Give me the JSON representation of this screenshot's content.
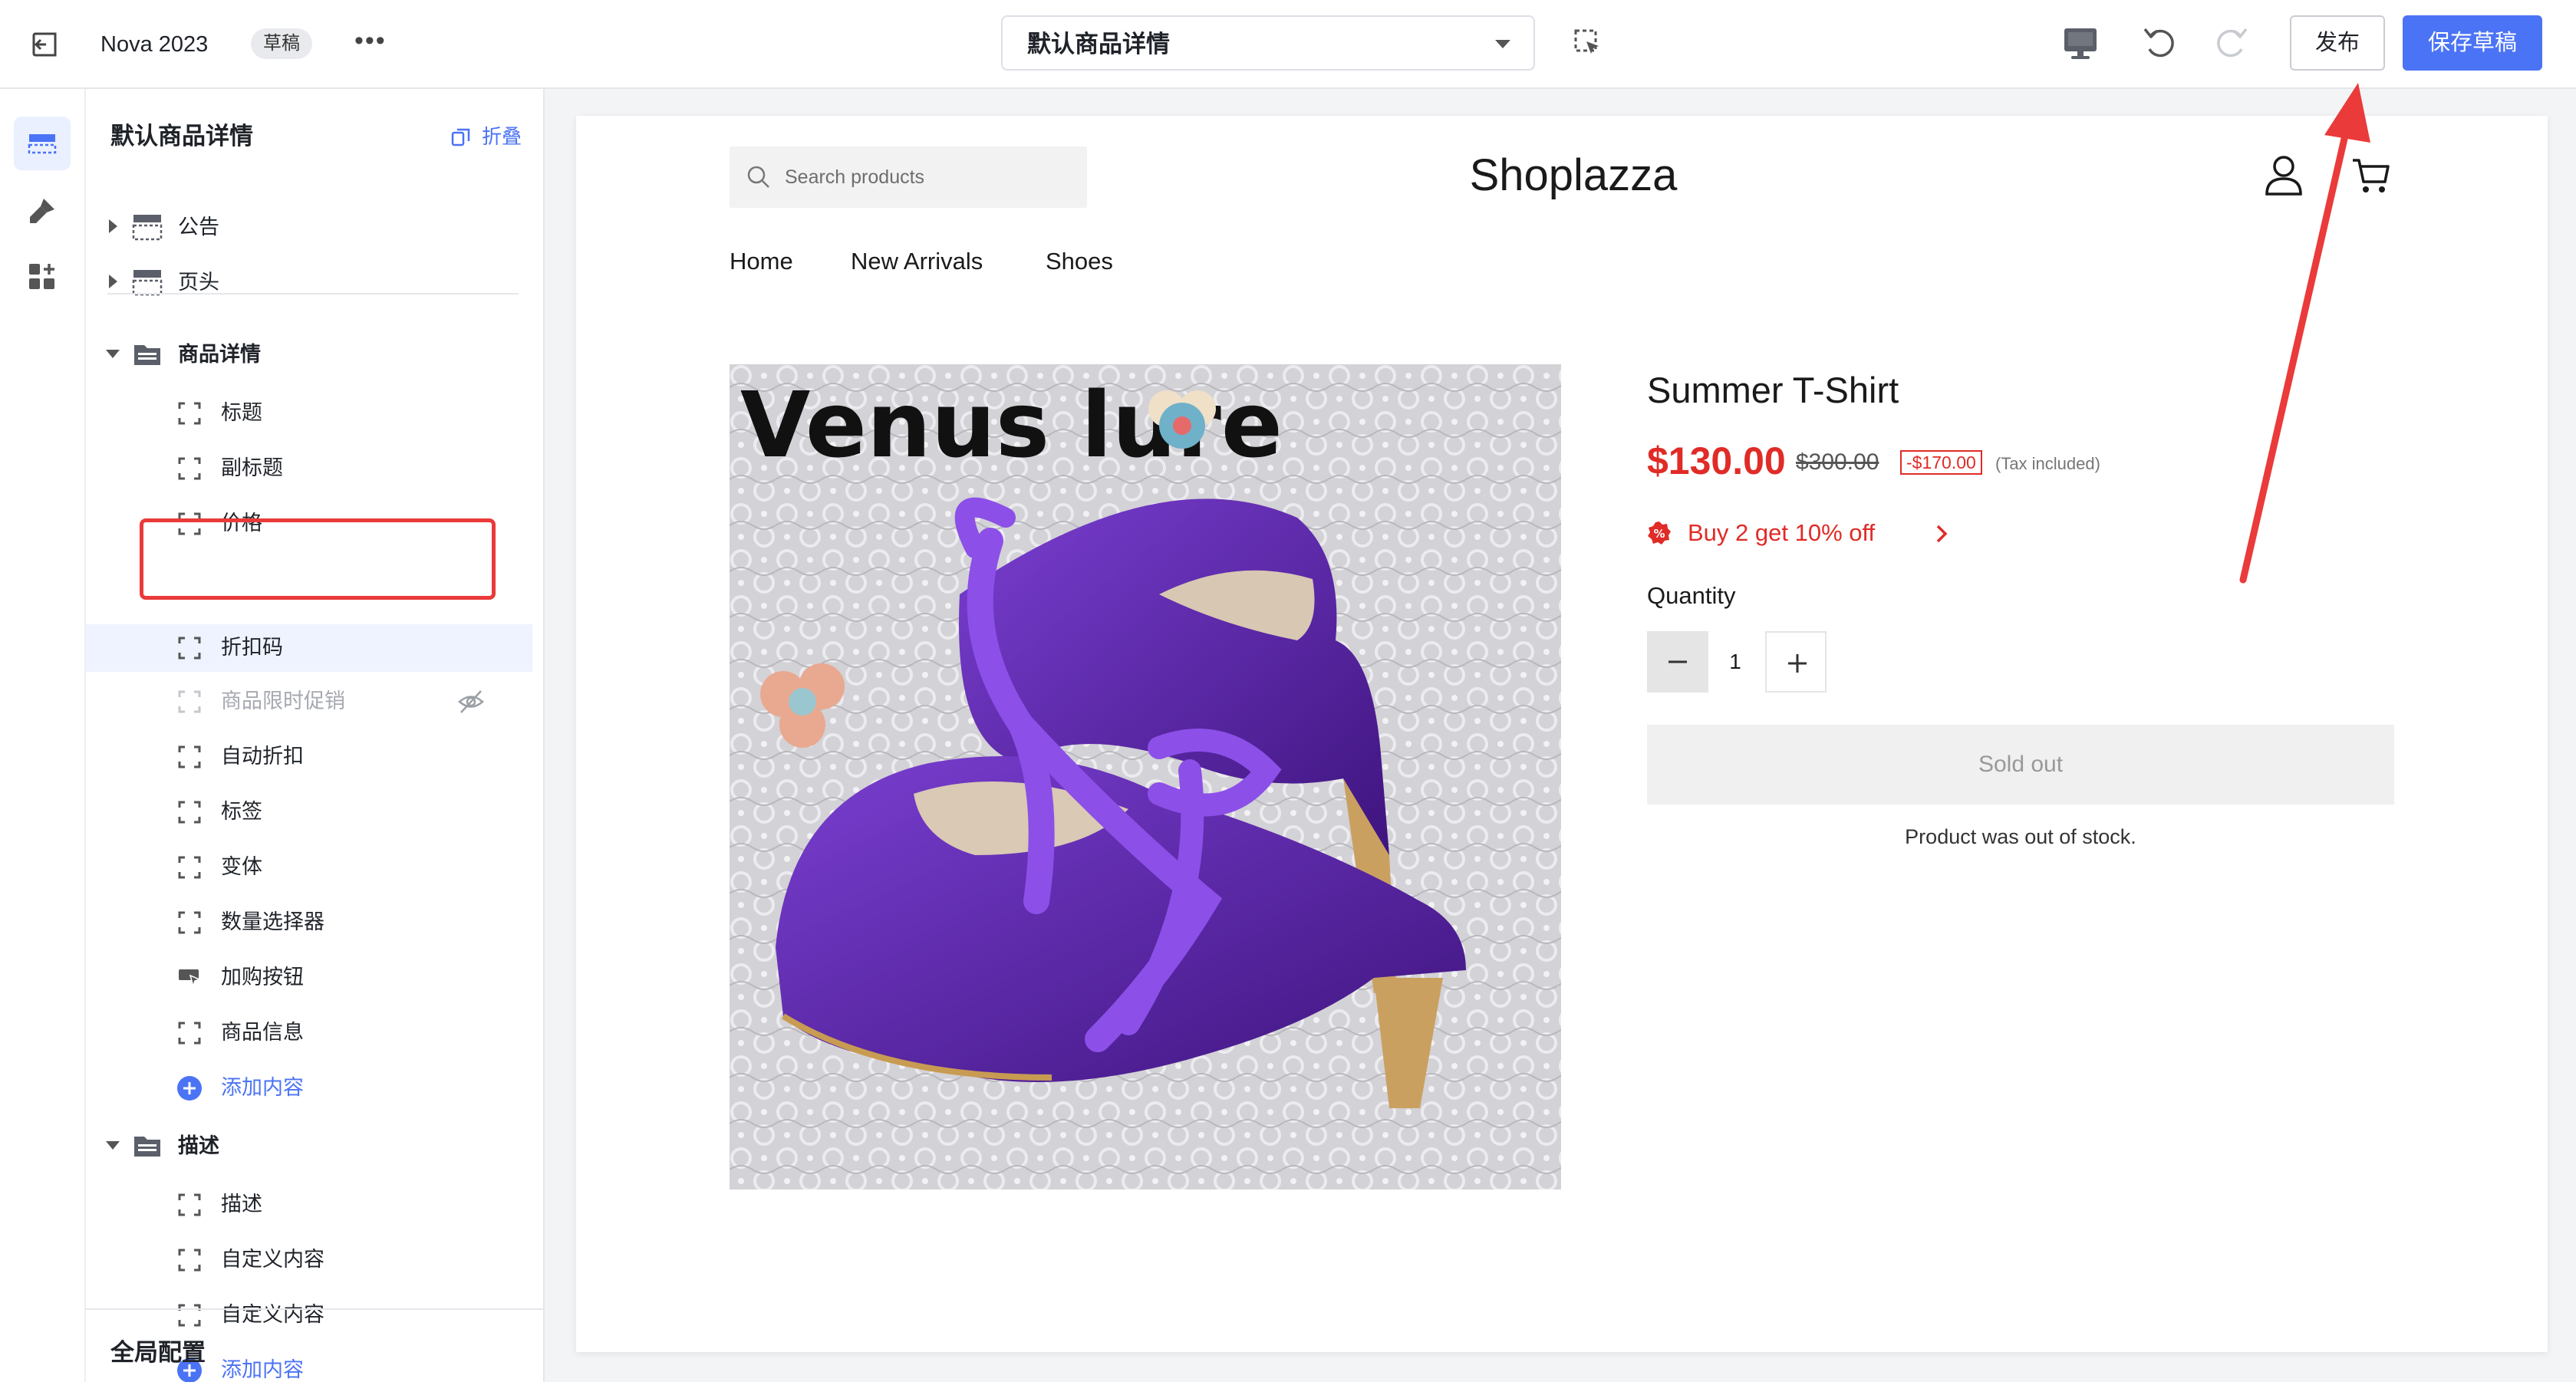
{
  "topbar": {
    "theme_name": "Nova 2023",
    "status_badge": "草稿",
    "more_label": "•••",
    "template_select": "默认商品详情",
    "publish_label": "发布",
    "save_draft_label": "保存草稿"
  },
  "sidebar": {
    "title": "默认商品详情",
    "collapse_label": "折叠",
    "sections": [
      {
        "label": "公告",
        "expanded": false
      },
      {
        "label": "页头",
        "expanded": false
      },
      {
        "label": "商品详情",
        "expanded": true
      },
      {
        "label": "描述",
        "expanded": true
      }
    ],
    "product_blocks": [
      {
        "label": "标题"
      },
      {
        "label": "副标题"
      },
      {
        "label": "价格"
      },
      {
        "label": "折扣码"
      },
      {
        "label": "商品限时促销"
      },
      {
        "label": "自动折扣"
      },
      {
        "label": "标签"
      },
      {
        "label": "变体"
      },
      {
        "label": "数量选择器"
      },
      {
        "label": "加购按钮"
      },
      {
        "label": "商品信息"
      }
    ],
    "product_add_label": "添加内容",
    "description_blocks": [
      {
        "label": "描述"
      },
      {
        "label": "自定义内容"
      },
      {
        "label": "自定义内容"
      }
    ],
    "description_add_label": "添加内容",
    "global_config": "全局配置"
  },
  "preview": {
    "search_placeholder": "Search products",
    "brand": "Shoplazza",
    "nav": [
      "Home",
      "New Arrivals",
      "Shoes"
    ],
    "image_watermark": "Venus lure",
    "product": {
      "title": "Summer T-Shirt",
      "price": "$130.00",
      "compare_price": "$300.00",
      "save_badge": "-$170.00",
      "tax_note": "(Tax included)",
      "promo": "Buy 2 get 10% off",
      "quantity_label": "Quantity",
      "quantity_value": "1",
      "sold_out_label": "Sold out",
      "out_of_stock_message": "Product was out of stock."
    }
  },
  "colors": {
    "accent": "#4b73f5",
    "price_red": "#e02b27",
    "annotation_red": "#ea3a3a",
    "shoe_purple": "#5b22b0"
  }
}
